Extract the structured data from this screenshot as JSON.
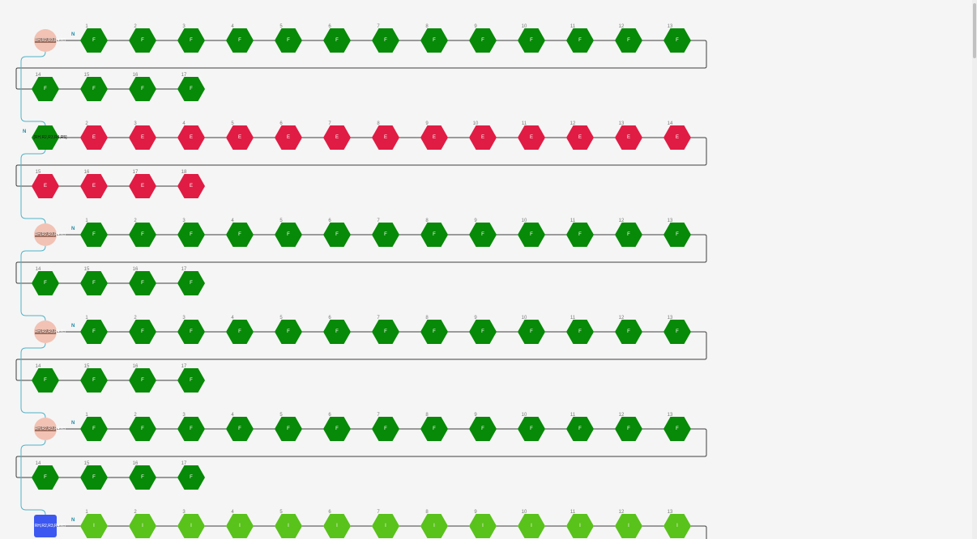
{
  "colors": {
    "background": "#f5f5f5",
    "green": "#078a07",
    "red": "#e01c44",
    "light_green": "#59c21b",
    "salmon": "#f2c2b4",
    "blue": "#3d58f0",
    "line": "#404040",
    "connector": "#4fb3c8",
    "n_label": "#1b8aa8"
  },
  "terminal_label": "N",
  "chains": [
    {
      "modification": {
        "label": "RH,R2,R3,R4,R5",
        "shape": "circle",
        "color_key": "salmon"
      },
      "residue_letter": "F",
      "color_key": "green",
      "count": 17
    },
    {
      "modification": {
        "label": "[RH,R2,R3,R4,R5]",
        "shape": "hexagon",
        "color_key": "green"
      },
      "residue_letter": "E",
      "color_key": "red",
      "count": 18,
      "n_label_outside": true
    },
    {
      "modification": {
        "label": "RH,R2,R3,R4,R5",
        "shape": "circle",
        "color_key": "salmon"
      },
      "residue_letter": "F",
      "color_key": "green",
      "count": 17
    },
    {
      "modification": {
        "label": "RH,R2,R3,R4,R5",
        "shape": "circle",
        "color_key": "salmon"
      },
      "residue_letter": "F",
      "color_key": "green",
      "count": 17
    },
    {
      "modification": {
        "label": "RH,R2,R3,R4,R5",
        "shape": "circle",
        "color_key": "salmon"
      },
      "residue_letter": "F",
      "color_key": "green",
      "count": 17
    },
    {
      "modification": {
        "label": "RH,R2,R3,R4,R5",
        "shape": "square",
        "color_key": "blue"
      },
      "residue_letter": "I",
      "color_key": "light_green",
      "count": 13
    }
  ]
}
